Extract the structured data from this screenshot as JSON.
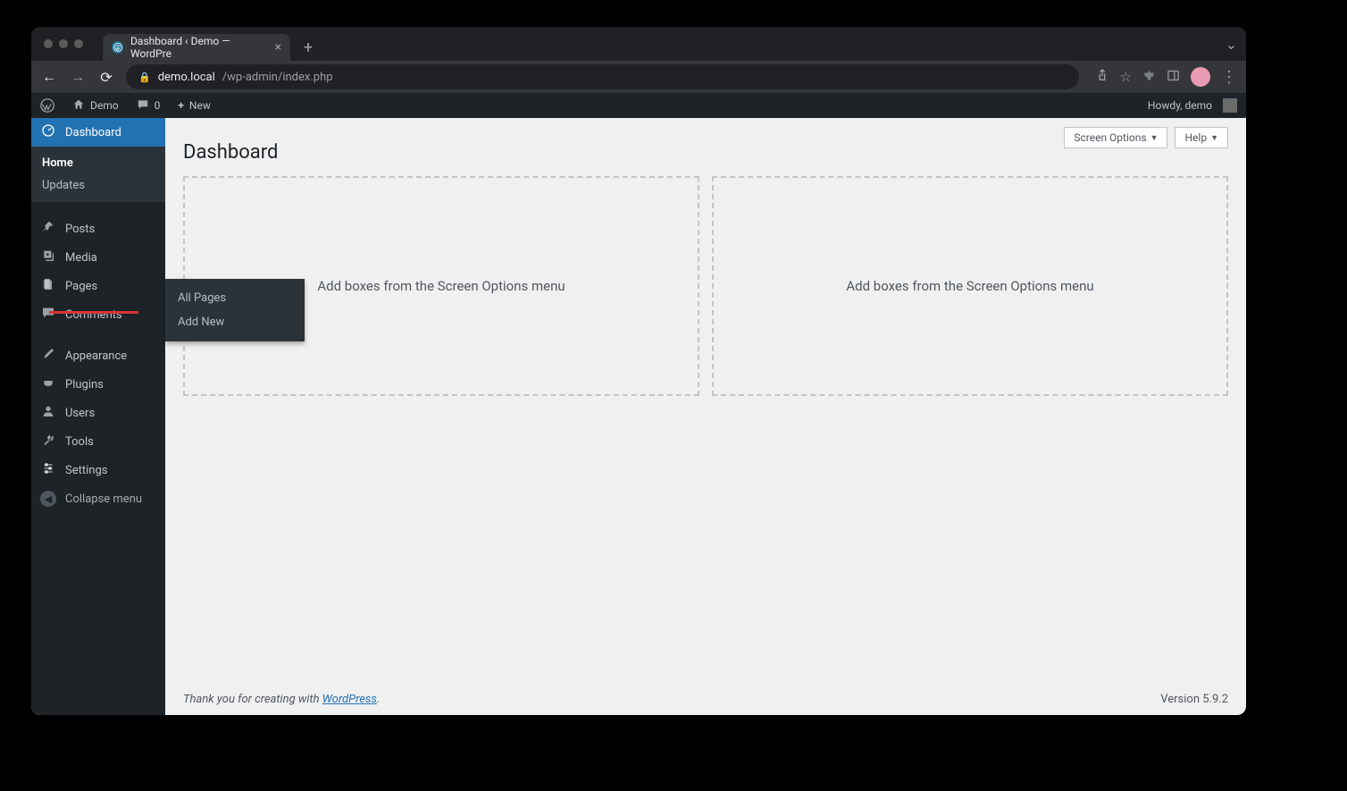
{
  "browser": {
    "tab_title": "Dashboard ‹ Demo — WordPre",
    "url_host": "demo.local",
    "url_path": "/wp-admin/index.php"
  },
  "adminbar": {
    "site_name": "Demo",
    "comments_count": "0",
    "new_label": "New",
    "howdy": "Howdy, demo"
  },
  "sidebar": {
    "dashboard": "Dashboard",
    "dashboard_sub": {
      "home": "Home",
      "updates": "Updates"
    },
    "posts": "Posts",
    "media": "Media",
    "pages": "Pages",
    "pages_flyout": {
      "all": "All Pages",
      "add": "Add New"
    },
    "comments": "Comments",
    "appearance": "Appearance",
    "plugins": "Plugins",
    "users": "Users",
    "tools": "Tools",
    "settings": "Settings",
    "collapse": "Collapse menu"
  },
  "screen_meta": {
    "screen_options": "Screen Options",
    "help": "Help"
  },
  "page": {
    "title": "Dashboard",
    "placeholder_text": "Add boxes from the Screen Options menu"
  },
  "footer": {
    "thank_prefix": "Thank you for creating with ",
    "wp_link": "WordPress",
    "thank_suffix": ".",
    "version": "Version 5.9.2"
  }
}
